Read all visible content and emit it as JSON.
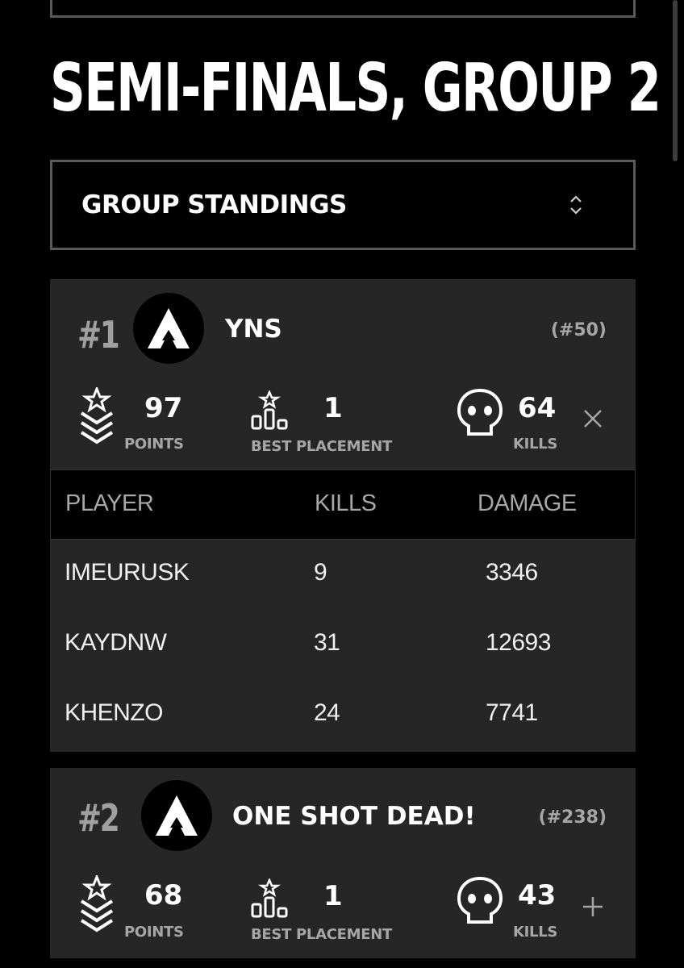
{
  "page": {
    "title": "SEMI-FINALS, GROUP 2"
  },
  "dropdown": {
    "label": "GROUP STANDINGS",
    "icon": "chevron-up-down-icon"
  },
  "table_columns": [
    "PLAYER",
    "KILLS",
    "DAMAGE"
  ],
  "teams": [
    {
      "rank": "#1",
      "name": "YNS",
      "seed": "(#50)",
      "points": "97",
      "points_label": "POINTS",
      "best_placement": "1",
      "best_placement_label": "BEST PLACEMENT",
      "kills": "64",
      "kills_label": "KILLS",
      "expanded": true,
      "toggle_icon": "close-icon",
      "players": [
        {
          "name": "IMEURUSK",
          "kills": "9",
          "damage": "3346"
        },
        {
          "name": "KAYDNW",
          "kills": "31",
          "damage": "12693"
        },
        {
          "name": "KHENZO",
          "kills": "24",
          "damage": "7741"
        }
      ]
    },
    {
      "rank": "#2",
      "name": "ONE SHOT DEAD!",
      "seed": "(#238)",
      "points": "68",
      "points_label": "POINTS",
      "best_placement": "1",
      "best_placement_label": "BEST PLACEMENT",
      "kills": "43",
      "kills_label": "KILLS",
      "expanded": false,
      "toggle_icon": "plus-icon"
    }
  ],
  "colors": {
    "background": "#000000",
    "card": "#262626",
    "muted_text": "#a6a6a6",
    "border": "#5a5a5a"
  }
}
